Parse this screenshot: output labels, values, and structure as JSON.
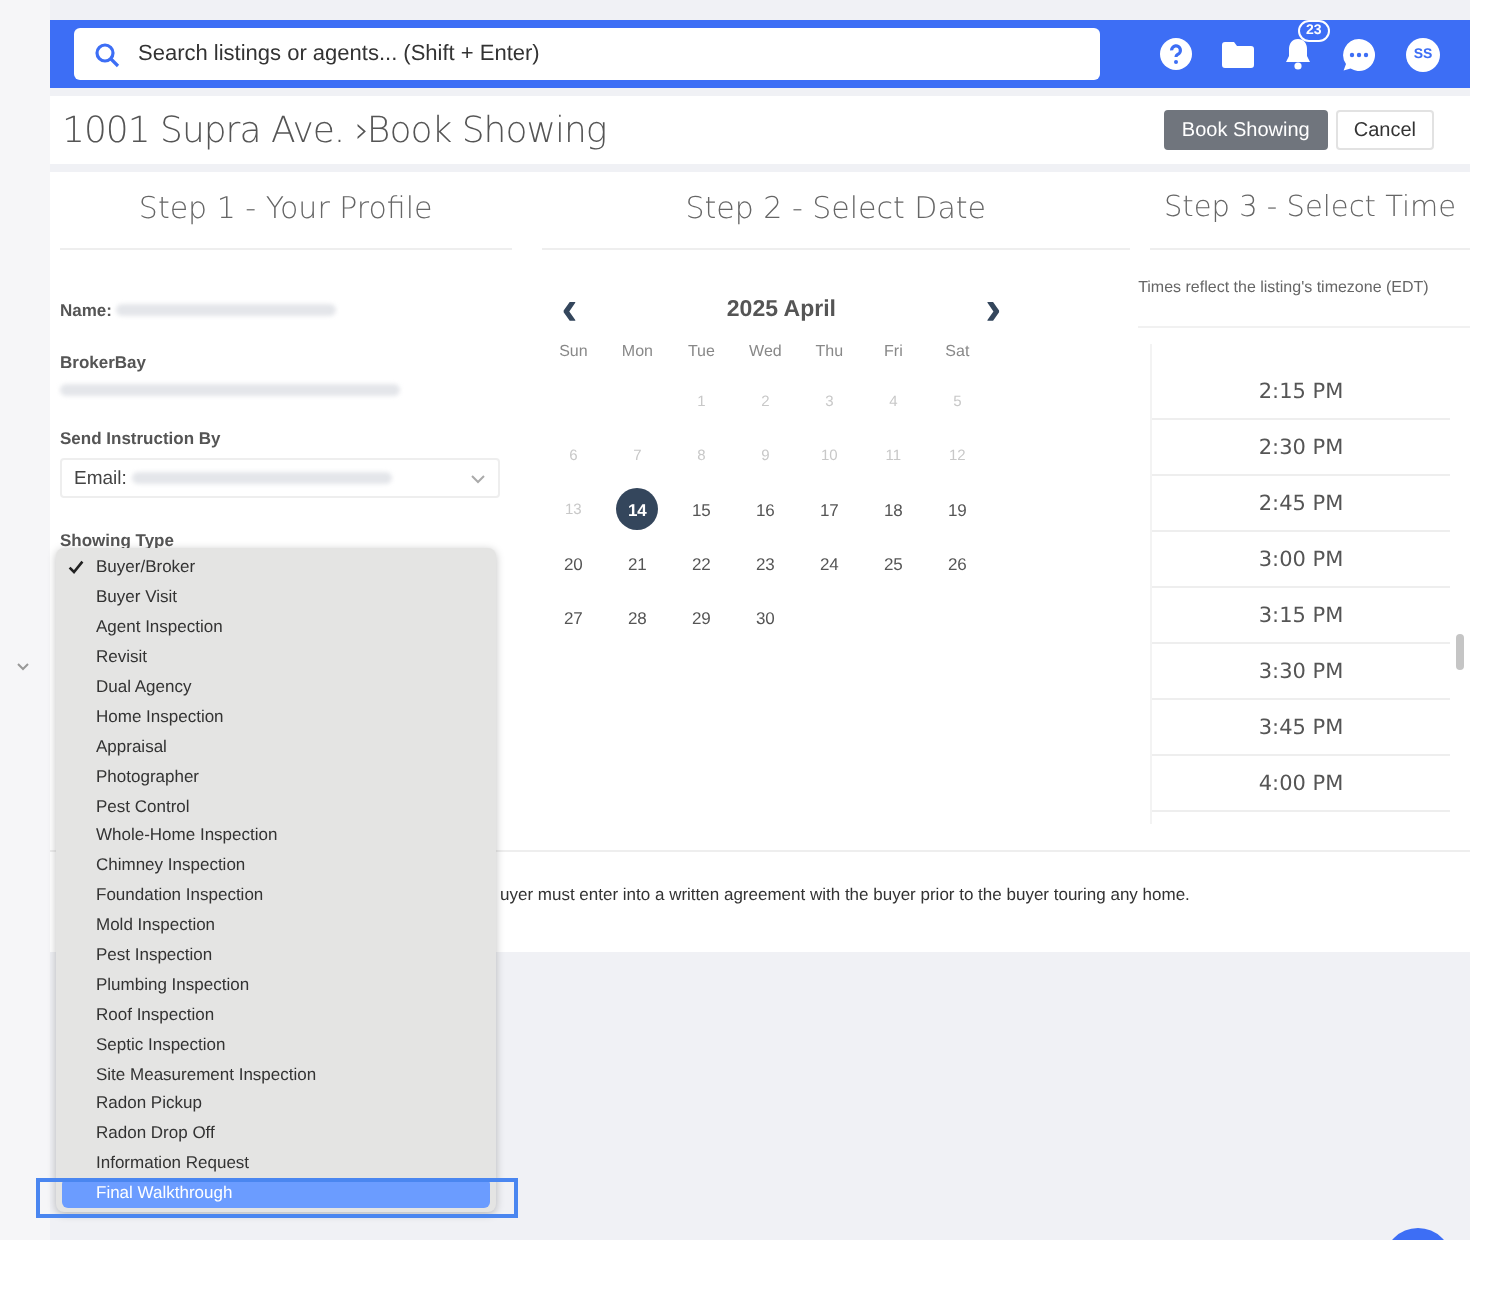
{
  "search": {
    "placeholder": "Search listings or agents... (Shift + Enter)"
  },
  "topbar": {
    "notification_count": "23",
    "avatar": "SS"
  },
  "header": {
    "listing": "1001 Supra Ave.",
    "separator": "›",
    "page": "Book Showing",
    "buttons": [
      {
        "label": "Book Showing",
        "kind": "primary"
      },
      {
        "label": "Cancel",
        "kind": "secondary"
      }
    ]
  },
  "steps": [
    "Step 1 - Your Profile",
    "Step 2 - Select Date",
    "Step 3 - Select Time"
  ],
  "profile": {
    "name_label": "Name:",
    "company": "BrokerBay",
    "send_label": "Send Instruction By",
    "send_prefix": "Email:",
    "showing_type_label": "Showing Type"
  },
  "calendar": {
    "title": "2025 April",
    "prev": "‹",
    "next": "›",
    "weekdays": [
      "Sun",
      "Mon",
      "Tue",
      "Wed",
      "Thu",
      "Fri",
      "Sat"
    ],
    "days": [
      {
        "kind": "blank"
      },
      {
        "kind": "blank"
      },
      {
        "kind": "day",
        "label": "1",
        "disabled": true,
        "selected": false
      },
      {
        "kind": "day",
        "label": "2",
        "disabled": true,
        "selected": false
      },
      {
        "kind": "day",
        "label": "3",
        "disabled": true,
        "selected": false
      },
      {
        "kind": "day",
        "label": "4",
        "disabled": true,
        "selected": false
      },
      {
        "kind": "day",
        "label": "5",
        "disabled": true,
        "selected": false
      },
      {
        "kind": "day",
        "label": "6",
        "disabled": true,
        "selected": false
      },
      {
        "kind": "day",
        "label": "7",
        "disabled": true,
        "selected": false
      },
      {
        "kind": "day",
        "label": "8",
        "disabled": true,
        "selected": false
      },
      {
        "kind": "day",
        "label": "9",
        "disabled": true,
        "selected": false
      },
      {
        "kind": "day",
        "label": "10",
        "disabled": true,
        "selected": false
      },
      {
        "kind": "day",
        "label": "11",
        "disabled": true,
        "selected": false
      },
      {
        "kind": "day",
        "label": "12",
        "disabled": true,
        "selected": false
      },
      {
        "kind": "day",
        "label": "13",
        "disabled": true,
        "selected": false
      },
      {
        "kind": "day",
        "label": "14",
        "disabled": false,
        "selected": true
      },
      {
        "kind": "day",
        "label": "15",
        "disabled": false,
        "selected": false
      },
      {
        "kind": "day",
        "label": "16",
        "disabled": false,
        "selected": false
      },
      {
        "kind": "day",
        "label": "17",
        "disabled": false,
        "selected": false
      },
      {
        "kind": "day",
        "label": "18",
        "disabled": false,
        "selected": false
      },
      {
        "kind": "day",
        "label": "19",
        "disabled": false,
        "selected": false
      },
      {
        "kind": "day",
        "label": "20",
        "disabled": false,
        "selected": false
      },
      {
        "kind": "day",
        "label": "21",
        "disabled": false,
        "selected": false
      },
      {
        "kind": "day",
        "label": "22",
        "disabled": false,
        "selected": false
      },
      {
        "kind": "day",
        "label": "23",
        "disabled": false,
        "selected": false
      },
      {
        "kind": "day",
        "label": "24",
        "disabled": false,
        "selected": false
      },
      {
        "kind": "day",
        "label": "25",
        "disabled": false,
        "selected": false
      },
      {
        "kind": "day",
        "label": "26",
        "disabled": false,
        "selected": false
      },
      {
        "kind": "day",
        "label": "27",
        "disabled": false,
        "selected": false
      },
      {
        "kind": "day",
        "label": "28",
        "disabled": false,
        "selected": false
      },
      {
        "kind": "day",
        "label": "29",
        "disabled": false,
        "selected": false
      },
      {
        "kind": "day",
        "label": "30",
        "disabled": false,
        "selected": false
      }
    ]
  },
  "times": {
    "note": "Times reflect the listing's timezone (EDT)",
    "slots": [
      "2:15 PM",
      "2:30 PM",
      "2:45 PM",
      "3:00 PM",
      "3:15 PM",
      "3:30 PM",
      "3:45 PM",
      "4:00 PM"
    ]
  },
  "notice": "uyer must enter into a written agreement with the buyer prior to the buyer touring any home.",
  "showing_type_menu": [
    {
      "label": "Buyer/Broker",
      "checked": true,
      "selected": false
    },
    {
      "label": "Buyer Visit",
      "checked": false,
      "selected": false
    },
    {
      "label": "Agent Inspection",
      "checked": false,
      "selected": false
    },
    {
      "label": "Revisit",
      "checked": false,
      "selected": false
    },
    {
      "label": "Dual Agency",
      "checked": false,
      "selected": false
    },
    {
      "label": "Home Inspection",
      "checked": false,
      "selected": false
    },
    {
      "label": "Appraisal",
      "checked": false,
      "selected": false
    },
    {
      "label": "Photographer",
      "checked": false,
      "selected": false
    },
    {
      "label": "Pest Control",
      "checked": false,
      "selected": false
    },
    {
      "label": "Whole-Home Inspection",
      "checked": false,
      "selected": false
    },
    {
      "label": "Chimney Inspection",
      "checked": false,
      "selected": false
    },
    {
      "label": "Foundation Inspection",
      "checked": false,
      "selected": false
    },
    {
      "label": "Mold Inspection",
      "checked": false,
      "selected": false
    },
    {
      "label": "Pest Inspection",
      "checked": false,
      "selected": false
    },
    {
      "label": "Plumbing Inspection",
      "checked": false,
      "selected": false
    },
    {
      "label": "Roof Inspection",
      "checked": false,
      "selected": false
    },
    {
      "label": "Septic Inspection",
      "checked": false,
      "selected": false
    },
    {
      "label": "Site Measurement Inspection",
      "checked": false,
      "selected": false
    },
    {
      "label": "Radon Pickup",
      "checked": false,
      "selected": false
    },
    {
      "label": "Radon Drop Off",
      "checked": false,
      "selected": false
    },
    {
      "label": "Information Request",
      "checked": false,
      "selected": false
    },
    {
      "label": "Final Walkthrough",
      "checked": false,
      "selected": true
    }
  ]
}
